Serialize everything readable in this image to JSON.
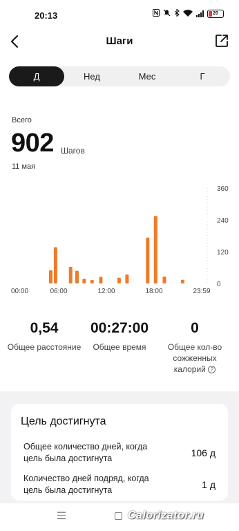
{
  "status_bar": {
    "time": "20:13",
    "battery": "20",
    "icons": [
      "nfc-icon",
      "mute-icon",
      "bluetooth-icon",
      "wifi-icon",
      "signal-icon",
      "battery-icon"
    ]
  },
  "header": {
    "title": "Шаги",
    "back_icon": "chevron-left-icon",
    "share_icon": "share-icon"
  },
  "tabs": [
    {
      "label": "Д",
      "active": true
    },
    {
      "label": "Нед",
      "active": false
    },
    {
      "label": "Мес",
      "active": false
    },
    {
      "label": "Г",
      "active": false
    }
  ],
  "summary": {
    "total_label": "Всего",
    "steps": "902",
    "unit": "Шагов",
    "date": "11 мая"
  },
  "chart_data": {
    "type": "bar",
    "x_tick_labels": [
      "00:00",
      "06:00",
      "12:00",
      "18:00",
      "23:59"
    ],
    "y_tick_labels": [
      "360",
      "240",
      "120",
      "0"
    ],
    "ylim": [
      0,
      360
    ],
    "x_unit": "hours",
    "values": [
      {
        "hour": 5.0,
        "steps": 50
      },
      {
        "hour": 5.6,
        "steps": 137
      },
      {
        "hour": 7.5,
        "steps": 63
      },
      {
        "hour": 8.3,
        "steps": 48
      },
      {
        "hour": 9.2,
        "steps": 18
      },
      {
        "hour": 10.2,
        "steps": 13
      },
      {
        "hour": 11.3,
        "steps": 25
      },
      {
        "hour": 13.6,
        "steps": 22
      },
      {
        "hour": 14.6,
        "steps": 34
      },
      {
        "hour": 17.2,
        "steps": 173
      },
      {
        "hour": 18.2,
        "steps": 255
      },
      {
        "hour": 19.3,
        "steps": 26
      },
      {
        "hour": 21.6,
        "steps": 14
      }
    ],
    "bar_color": "#f07a2a",
    "grid": false
  },
  "stats": {
    "distance": {
      "value": "0,54",
      "label": "Общее расстояние"
    },
    "time": {
      "value": "00:27:00",
      "label": "Общее время"
    },
    "calories": {
      "value": "0",
      "label_line1": "Общее кол-во",
      "label_line2": "сожженных",
      "label_line3": "калорий",
      "help_icon": "?"
    }
  },
  "goal": {
    "title": "Цель достигнута",
    "rows": [
      {
        "line1": "Общее количество дней, когда",
        "line2": "цель была достигнута",
        "value": "106 д"
      },
      {
        "line1": "Количество дней подряд, когда",
        "line2": "цель была достигнута",
        "value": "1 д"
      }
    ]
  },
  "watermark": "Calorizator.ru",
  "colors": {
    "accent": "#f07a2a",
    "tab_active_bg": "#1a1a1a",
    "panel_bg": "#f2f2f4"
  }
}
